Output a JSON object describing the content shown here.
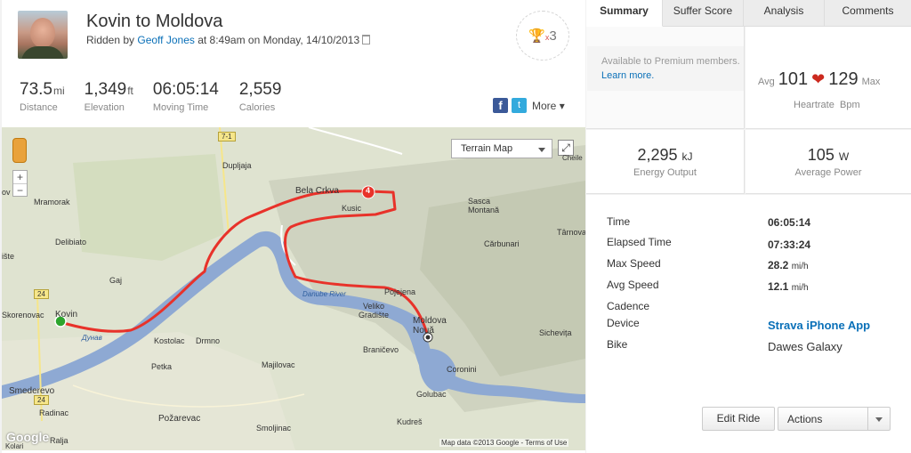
{
  "activity": {
    "title": "Kovin to Moldova",
    "ridden_by_prefix": "Ridden by ",
    "athlete": "Geoff Jones",
    "date_text": " at 8:49am on Monday, 14/10/2013",
    "trophy_count": "3",
    "trophy_multiplier": "x"
  },
  "stats": [
    {
      "value": "73.5",
      "unit": "mi",
      "label": "Distance"
    },
    {
      "value": "1,349",
      "unit": "ft",
      "label": "Elevation"
    },
    {
      "value": "06:05:14",
      "unit": "",
      "label": "Moving Time"
    },
    {
      "value": "2,559",
      "unit": "",
      "label": "Calories"
    }
  ],
  "share": {
    "more_label": "More"
  },
  "map": {
    "type_selector": "Terrain Map",
    "credit": "Map data ©2013 Google - Terms of Use",
    "logo": "Google",
    "labels": {
      "dupljaja": "Dupljaja",
      "mramorak": "Mramorak",
      "deliblato": "Delibiato",
      "bela_crkva": "Bela Crkva",
      "kusic": "Kusic",
      "sasca": "Sasca Montană",
      "carbunari": "Cărbunari",
      "tarnova": "Târnova",
      "gaj": "Gaj",
      "kovin": "Kovin",
      "skorenovac": "Skorenovac",
      "kostolac": "Kostolac",
      "drmno": "Drmno",
      "petka": "Petka",
      "majilovac": "Majilovac",
      "veliko_gradiste": "Veliko Gradište",
      "moldova": "Moldova Nouă",
      "pojejena": "Pojejena",
      "branicevo": "Braničevo",
      "coronini": "Coronini",
      "sichevita": "Sichevița",
      "golubac": "Golubac",
      "kudres": "Kudreš",
      "smederevo": "Smederevo",
      "radinac": "Radinac",
      "pozarevac": "Požarevac",
      "smoljinac": "Smoljinac",
      "ralja": "Ralja",
      "kolari": "Kolari",
      "iste": "ište",
      "danube_river": "Danube River",
      "dunav": "Дунав",
      "ov": "ov",
      "cheile": "Cheile"
    },
    "road_24a": "24",
    "road_24b": "24",
    "road_71": "7-1",
    "marker_label": "4"
  },
  "tabs": [
    "Summary",
    "Suffer Score",
    "Analysis",
    "Comments"
  ],
  "premium": {
    "text": "Available to Premium members. ",
    "link": "Learn more."
  },
  "heartrate": {
    "avg_label": "Avg",
    "avg": "101",
    "max": "129",
    "max_label": "Max",
    "label": "Heartrate",
    "unit": "Bpm"
  },
  "energy": {
    "value": "2,295",
    "unit": "kJ",
    "label": "Energy Output"
  },
  "power": {
    "value": "105",
    "unit": "W",
    "label": "Average Power"
  },
  "details": {
    "time_label": "Time",
    "time": "06:05:14",
    "elapsed_label": "Elapsed Time",
    "elapsed": "07:33:24",
    "max_speed_label": "Max Speed",
    "max_speed": "28.2",
    "max_speed_unit": "mi/h",
    "avg_speed_label": "Avg Speed",
    "avg_speed": "12.1",
    "avg_speed_unit": "mi/h",
    "cadence_label": "Cadence",
    "device_label": "Device",
    "device": "Strava iPhone App",
    "bike_label": "Bike",
    "bike": "Dawes Galaxy"
  },
  "buttons": {
    "edit": "Edit Ride",
    "actions": "Actions"
  },
  "colors": {
    "route": "#e8322a",
    "link": "#0a70b8",
    "heart": "#cc2a1f",
    "water": "#8ea9d3"
  }
}
